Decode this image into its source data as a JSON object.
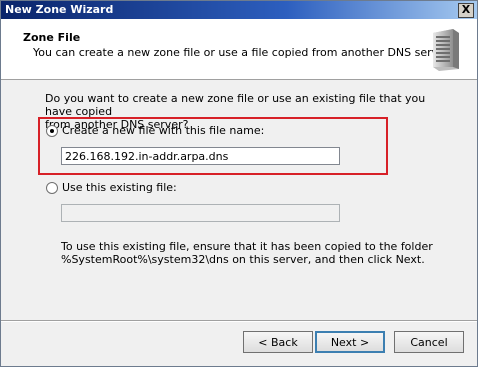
{
  "window": {
    "title": "New Zone Wizard",
    "close_glyph": "X"
  },
  "header": {
    "title": "Zone File",
    "subtitle": "You can create a new zone file or use a file copied from another DNS server.",
    "icon": "server-icon"
  },
  "body": {
    "question_line1": "Do you want to create a new zone file or use an existing file that you have copied",
    "question_line2": "from another DNS server?",
    "option_new": {
      "label": "Create a new file with this file name:",
      "selected": true
    },
    "new_file_value": "226.168.192.in-addr.arpa.dns",
    "option_existing": {
      "label": "Use this existing file:",
      "selected": false
    },
    "existing_file_value": "",
    "note_line1": "To use this existing file, ensure that it has been copied to the folder",
    "note_line2": "%SystemRoot%\\system32\\dns on this server, and then click Next."
  },
  "buttons": {
    "back": "< Back",
    "next": "Next >",
    "cancel": "Cancel"
  },
  "colors": {
    "highlight": "#d72027",
    "titlebar": "#0a246a"
  }
}
